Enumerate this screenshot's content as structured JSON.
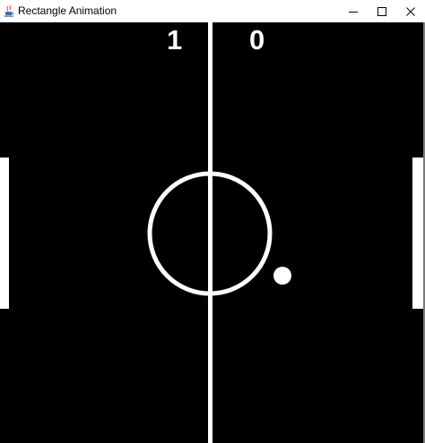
{
  "window": {
    "title": "Rectangle Animation",
    "icon": "java-cup-icon",
    "controls": [
      "minimize-icon",
      "maximize-icon",
      "close-icon"
    ]
  },
  "game": {
    "score_left": "1",
    "score_right": "0"
  },
  "colors": {
    "field": "#000000",
    "lines": "#ffffff",
    "titlebar": "#ffffff"
  }
}
